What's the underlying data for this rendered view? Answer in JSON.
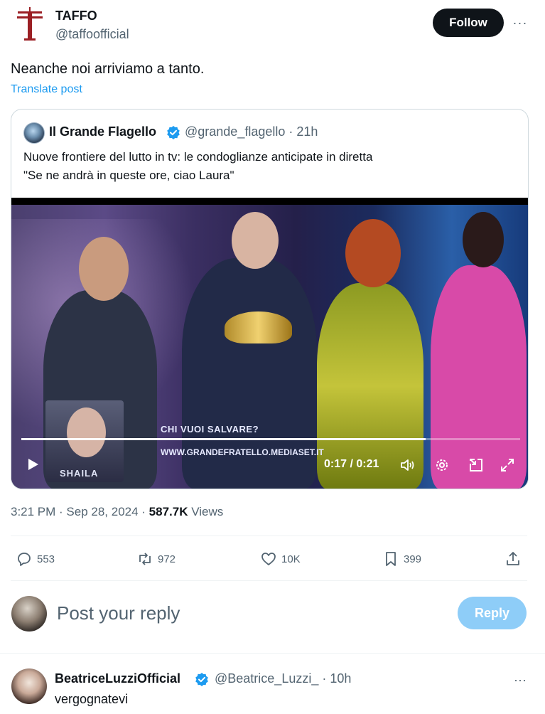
{
  "post": {
    "author_name": "TAFFO",
    "author_handle": "@taffoofficial",
    "follow_label": "Follow",
    "more_label": "···",
    "text": "Neanche noi arriviamo a tanto.",
    "translate_label": "Translate post"
  },
  "quote": {
    "name": "Il Grande Flagello",
    "meta": "@grande_flagello · 21h",
    "text_line1": "Nuove frontiere del lutto in tv: le condoglianze anticipate in diretta",
    "text_line2": "\"Se ne andrà in queste ore, ciao Laura\"",
    "video": {
      "overlay_question": "CHI VUOI SALVARE?",
      "overlay_site": "WWW.GRANDEFRATELLO.MEDIASET.IT",
      "overlay_name": "SHAILA",
      "time": "0:17 / 0:21",
      "progress": 0.81
    }
  },
  "stats": {
    "time": "3:21 PM · Sep 28, 2024 · ",
    "views_count": "587.7K",
    "views_label": " Views"
  },
  "actions": {
    "replies": "553",
    "retweets": "972",
    "likes": "10K",
    "bookmarks": "399"
  },
  "reply_box": {
    "placeholder": "Post your reply",
    "button_label": "Reply"
  },
  "comment": {
    "name": "BeatriceLuzziOfficial",
    "meta": "@Beatrice_Luzzi_ · 10h",
    "more_label": "···",
    "text": "vergognatevi"
  },
  "colors": {
    "accent": "#1d9bf0",
    "logo_red": "#9b1f24",
    "text_secondary": "#536471"
  }
}
